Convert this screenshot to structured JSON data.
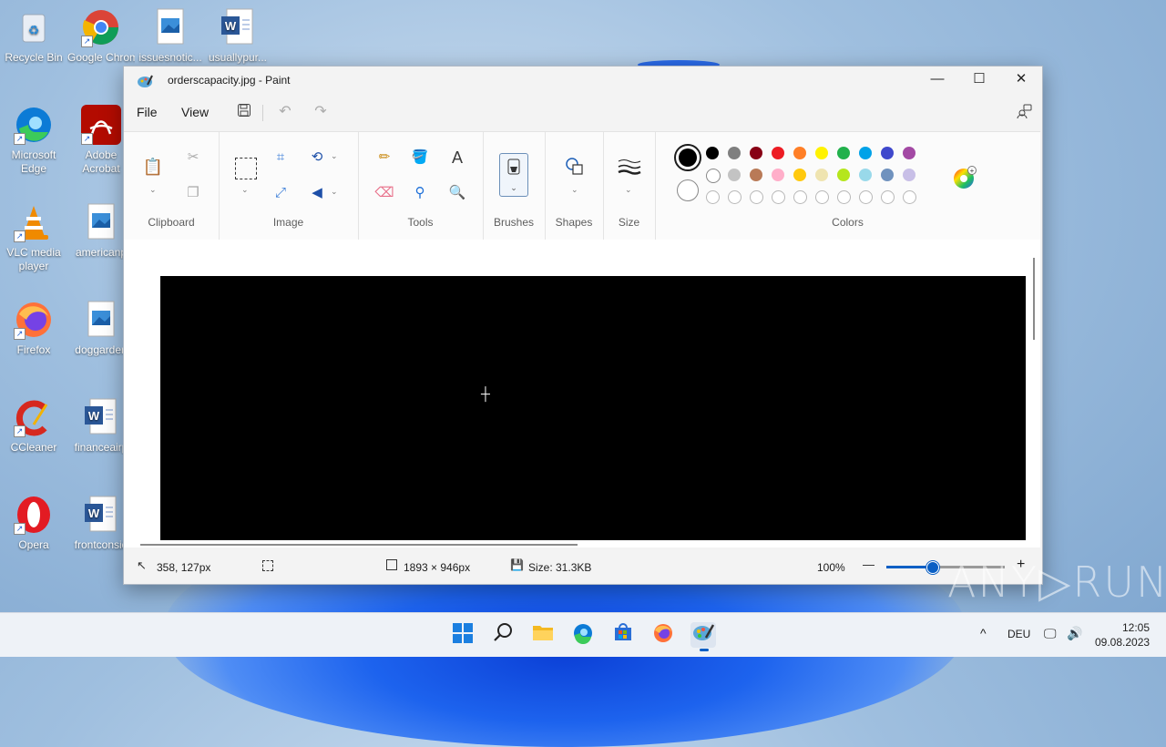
{
  "desktop": {
    "icons": [
      {
        "label": "Recycle Bin",
        "icon": "recycle-bin-icon"
      },
      {
        "label": "Google Chrome",
        "icon": "chrome-icon"
      },
      {
        "label": "issuesnotic...",
        "icon": "image-file-icon"
      },
      {
        "label": "usuallypur...",
        "icon": "word-file-icon"
      },
      {
        "label": "Microsoft Edge",
        "icon": "edge-icon"
      },
      {
        "label": "Adobe Acrobat",
        "icon": "acrobat-icon"
      },
      {
        "label": "VLC media player",
        "icon": "vlc-icon"
      },
      {
        "label": "americanp",
        "icon": "image-file-icon"
      },
      {
        "label": "Firefox",
        "icon": "firefox-icon"
      },
      {
        "label": "doggarden",
        "icon": "image-file-icon"
      },
      {
        "label": "CCleaner",
        "icon": "ccleaner-icon"
      },
      {
        "label": "financeairp",
        "icon": "word-file-icon"
      },
      {
        "label": "Opera",
        "icon": "opera-icon"
      },
      {
        "label": "frontconsid",
        "icon": "word-file-icon"
      }
    ]
  },
  "window": {
    "title": "orderscapacity.jpg - Paint",
    "minimize": "—",
    "maximize": "☐",
    "close": "✕"
  },
  "menu": {
    "file": "File",
    "view": "View"
  },
  "ribbon": {
    "clipboard": "Clipboard",
    "image": "Image",
    "tools": "Tools",
    "brushes": "Brushes",
    "shapes": "Shapes",
    "size": "Size",
    "colors": "Colors"
  },
  "colors": {
    "primary": "#000000",
    "secondary": "#ffffff",
    "palette_row1": [
      "#000000",
      "#7f7f7f",
      "#880015",
      "#ed1c24",
      "#ff7f27",
      "#fff200",
      "#22b14c",
      "#00a2e8",
      "#3f48cc",
      "#a349a4"
    ],
    "palette_row2": [
      "#ffffff",
      "#c3c3c3",
      "#b97a57",
      "#ffaec9",
      "#ffc90e",
      "#efe4b0",
      "#b5e61d",
      "#99d9ea",
      "#7092be",
      "#c8bfe7"
    ],
    "accent": "#0a5fc4"
  },
  "status": {
    "cursor_pos": "358, 127px",
    "canvas_size": "1893 × 946px",
    "file_size": "Size: 31.3KB",
    "zoom": "100%",
    "zoom_minus": "—",
    "zoom_plus": "+"
  },
  "watermark": "ANY▷RUN",
  "taskbar": {
    "lang": "DEU",
    "time": "12:05",
    "date": "09.08.2023"
  }
}
